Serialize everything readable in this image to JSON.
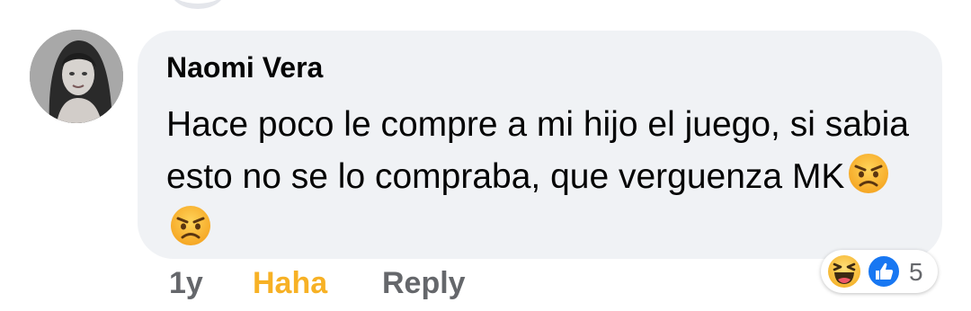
{
  "comment": {
    "author": "Naomi Vera",
    "text": "Hace poco le compre a mi hijo el juego, si sabia esto no se lo compraba, que verguenza MK",
    "inline_emojis": [
      "angry-face",
      "angry-face"
    ]
  },
  "actions": {
    "time": "1y",
    "reaction_label": "Haha",
    "reply_label": "Reply"
  },
  "reactions": {
    "icons": [
      "haha-icon",
      "like-icon"
    ],
    "count": "5"
  },
  "colors": {
    "bubble": "#f0f2f5",
    "haha_active": "#f7b125",
    "muted": "#65676b",
    "like_blue": "#1877f2"
  }
}
